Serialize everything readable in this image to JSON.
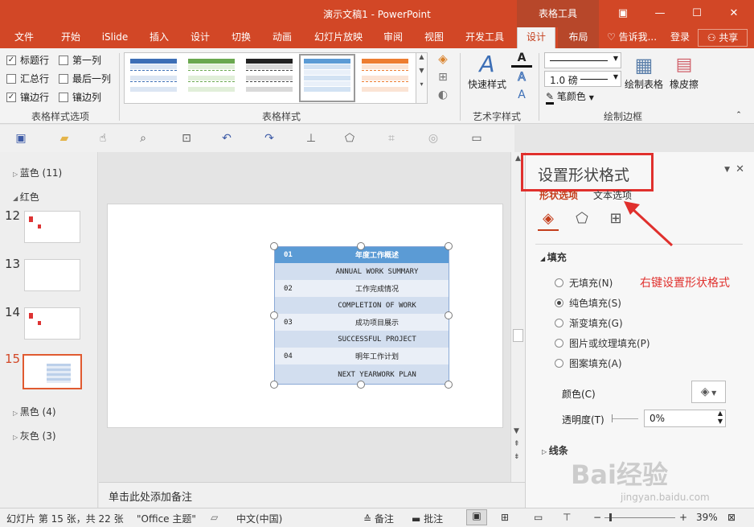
{
  "window": {
    "title": "演示文稿1 - PowerPoint",
    "context_tab_group": "表格工具",
    "buttons": {
      "restore_ribbon": "▣",
      "minimize": "—",
      "maximize": "☐",
      "close": "✕"
    }
  },
  "tabs": [
    {
      "label": "文件"
    },
    {
      "label": "开始"
    },
    {
      "label": "iSlide"
    },
    {
      "label": "插入"
    },
    {
      "label": "设计"
    },
    {
      "label": "切换"
    },
    {
      "label": "动画"
    },
    {
      "label": "幻灯片放映"
    },
    {
      "label": "审阅"
    },
    {
      "label": "视图"
    },
    {
      "label": "开发工具"
    },
    {
      "label": "设计"
    },
    {
      "label": "布局"
    }
  ],
  "tab_extras": {
    "tell_me": "告诉我...",
    "sign_in": "登录",
    "share": "共享"
  },
  "ribbon": {
    "table_style_options": {
      "group_label": "表格样式选项",
      "options": [
        {
          "label": "标题行",
          "checked": true
        },
        {
          "label": "第一列",
          "checked": false
        },
        {
          "label": "汇总行",
          "checked": false
        },
        {
          "label": "最后一列",
          "checked": false
        },
        {
          "label": "镶边行",
          "checked": true
        },
        {
          "label": "镶边列",
          "checked": false
        }
      ]
    },
    "table_styles": {
      "group_label": "表格样式",
      "styles": [
        "#3d6fb6",
        "#6aa84f",
        "#444444",
        "#5b9bd5",
        "#ed7d31"
      ]
    },
    "wordart": {
      "group_label": "艺术字样式",
      "quick_styles": "快速样式"
    },
    "borders": {
      "group_label": "绘制边框",
      "pen_weight": "1.0 磅",
      "pen_color": "笔颜色",
      "draw_table": "绘制表格",
      "eraser": "橡皮擦"
    }
  },
  "slide_pane": {
    "sections": [
      {
        "label": "蓝色 (11)",
        "expanded": false
      },
      {
        "label": "红色",
        "expanded": true
      },
      {
        "label": "黑色 (4)",
        "expanded": false
      },
      {
        "label": "灰色 (3)",
        "expanded": false
      }
    ],
    "slides": [
      {
        "num": "12"
      },
      {
        "num": "13"
      },
      {
        "num": "14"
      },
      {
        "num": "15",
        "selected": true
      }
    ]
  },
  "slide_table": {
    "header": {
      "num": "01",
      "text": "年度工作概述"
    },
    "rows": [
      {
        "num": "",
        "text": "ANNUAL WORK SUMMARY"
      },
      {
        "num": "02",
        "text": "工作完成情况"
      },
      {
        "num": "",
        "text": "COMPLETION OF WORK"
      },
      {
        "num": "03",
        "text": "成功项目展示"
      },
      {
        "num": "",
        "text": "SUCCESSFUL PROJECT"
      },
      {
        "num": "04",
        "text": "明年工作计划"
      },
      {
        "num": "",
        "text": "NEXT YEARWORK PLAN"
      }
    ]
  },
  "notes": {
    "placeholder": "单击此处添加备注"
  },
  "format_pane": {
    "title": "设置形状格式",
    "tabs": [
      "形状选项",
      "文本选项"
    ],
    "fill_section": "填充",
    "fill_options": [
      {
        "label": "无填充(N)",
        "selected": false
      },
      {
        "label": "纯色填充(S)",
        "selected": true
      },
      {
        "label": "渐变填充(G)",
        "selected": false
      },
      {
        "label": "图片或纹理填充(P)",
        "selected": false
      },
      {
        "label": "图案填充(A)",
        "selected": false
      }
    ],
    "color_label": "颜色(C)",
    "transparency_label": "透明度(T)",
    "transparency_value": "0%",
    "line_section": "线条",
    "annotation": "右键设置形状格式"
  },
  "status_bar": {
    "slide_info": "幻灯片 第 15 张，共 22 张",
    "theme": "\"Office 主题\"",
    "language": "中文(中国)",
    "notes": "备注",
    "comments": "批注",
    "zoom": "39%"
  },
  "watermark": {
    "text": "Bai经验",
    "sub": "jingyan.baidu.com"
  }
}
